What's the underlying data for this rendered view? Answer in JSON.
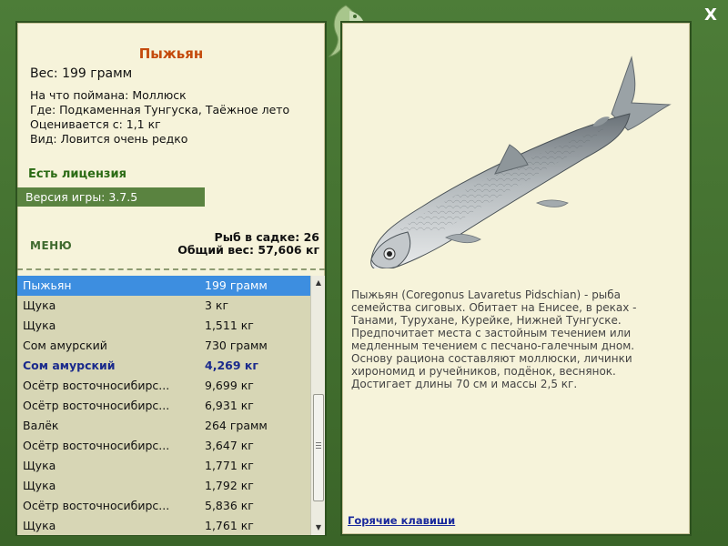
{
  "fish": {
    "name": "Пыжьян",
    "weight": "Вес: 199 грамм",
    "caught_on": "На что поймана: Моллюск",
    "location": "Где: Подкаменная Тунгуска, Таёжное лето",
    "valued_from": "Оценивается с: 1,1 кг",
    "rarity": "Вид: Ловится очень редко"
  },
  "license": "Есть лицензия",
  "version": "Версия игры: 3.7.5",
  "menu_label": "МЕНЮ",
  "stats": {
    "fish_count": "Рыб в садке: 26",
    "total_weight": "Общий вес: 57,606 кг"
  },
  "catch_list": [
    {
      "name": "Пыжьян",
      "weight": "199 грамм"
    },
    {
      "name": "Щука",
      "weight": "3 кг"
    },
    {
      "name": "Щука",
      "weight": "1,511 кг"
    },
    {
      "name": "Сом амурский",
      "weight": "730 грамм"
    },
    {
      "name": "Сом амурский",
      "weight": "4,269 кг"
    },
    {
      "name": "Осётр восточносибирс...",
      "weight": "9,699 кг"
    },
    {
      "name": "Осётр восточносибирс...",
      "weight": "6,931 кг"
    },
    {
      "name": "Валёк",
      "weight": "264 грамм"
    },
    {
      "name": "Осётр восточносибирс...",
      "weight": "3,647 кг"
    },
    {
      "name": "Щука",
      "weight": "1,771 кг"
    },
    {
      "name": "Щука",
      "weight": "1,792 кг"
    },
    {
      "name": "Осётр восточносибирс...",
      "weight": "5,836 кг"
    },
    {
      "name": "Щука",
      "weight": "1,761 кг"
    }
  ],
  "description": "Пыжьян (Coregonus Lavaretus Pidschian) - рыба семейства сиговых. Обитает на Енисее, в реках - Танами, Турухане, Курейке, Нижней Тунгуске. Предпочитает места с застойным течением или медленным течением с песчано-галечным дном. Основу рациона составляют моллюски, личинки хирономид и ручейников, подёнок, веснянок. Достигает длины 70 см и массы 2,5 кг.",
  "hotkeys_label": "Горячие клавиши",
  "close_label": "X",
  "colors": {
    "frame": "#3f6a2e",
    "panel": "#f6f3da",
    "title": "#c44a0c",
    "license": "#2b6b14",
    "selected_row": "#3d8ee0",
    "highlight_row": "#1a2a8c",
    "link": "#1a2a9c"
  },
  "icons": {
    "close": "close-icon",
    "emblem": "fish-emblem-icon",
    "fish_picture": "fish-illustration"
  }
}
